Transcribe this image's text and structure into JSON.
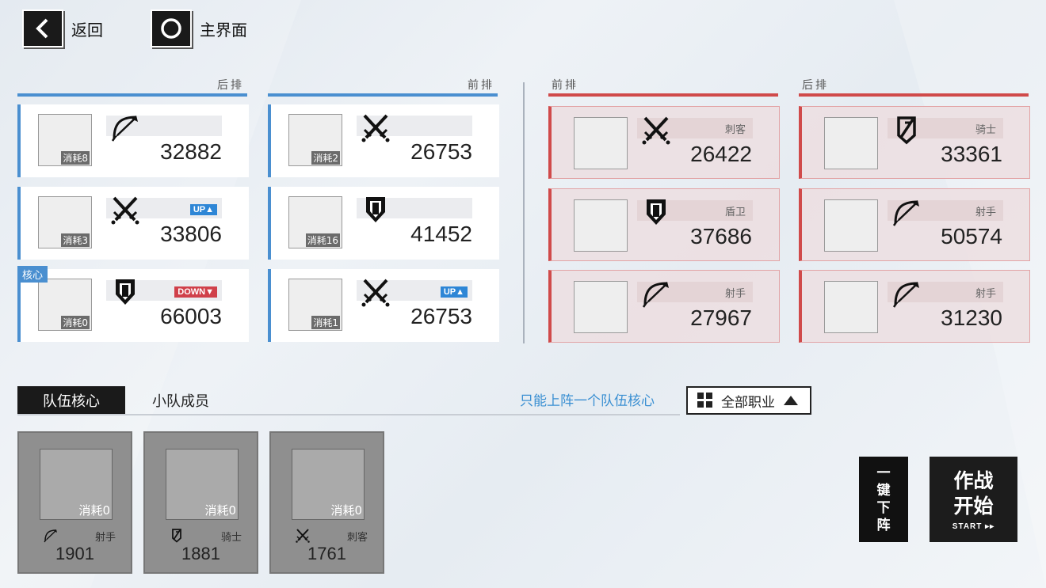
{
  "nav": {
    "back_label": "返回",
    "home_label": "主界面"
  },
  "sections": {
    "ally_back": "后排",
    "ally_front": "前排",
    "enemy_front": "前排",
    "enemy_back": "后排"
  },
  "ally_back": [
    {
      "cost": "消耗8",
      "class_icon": "bow-icon",
      "power": "32882",
      "badge": "",
      "core": ""
    },
    {
      "cost": "消耗3",
      "class_icon": "daggers-icon",
      "power": "33806",
      "badge": "UP▲",
      "core": ""
    },
    {
      "cost": "消耗0",
      "class_icon": "shield-icon",
      "power": "66003",
      "badge": "DOWN▼",
      "core": "核心"
    }
  ],
  "ally_front": [
    {
      "cost": "消耗2",
      "class_icon": "daggers-icon",
      "power": "26753",
      "badge": ""
    },
    {
      "cost": "消耗16",
      "class_icon": "shield-icon",
      "power": "41452",
      "badge": ""
    },
    {
      "cost": "消耗1",
      "class_icon": "daggers-icon",
      "power": "26753",
      "badge": "UP▲"
    }
  ],
  "enemy_front": [
    {
      "class_icon": "daggers-icon",
      "class": "刺客",
      "power": "26422"
    },
    {
      "class_icon": "shield-icon",
      "class": "盾卫",
      "power": "37686"
    },
    {
      "class_icon": "bow-icon",
      "class": "射手",
      "power": "27967"
    }
  ],
  "enemy_back": [
    {
      "class_icon": "knight-icon",
      "class": "骑士",
      "power": "33361"
    },
    {
      "class_icon": "bow-icon",
      "class": "射手",
      "power": "50574"
    },
    {
      "class_icon": "bow-icon",
      "class": "射手",
      "power": "31230"
    }
  ],
  "tabs": {
    "core": "队伍核心",
    "members": "小队成员"
  },
  "hint": "只能上阵一个队伍核心",
  "filter": {
    "label": "全部职业"
  },
  "pool": [
    {
      "cost": "消耗0",
      "class": "射手",
      "class_icon": "bow-icon",
      "power": "1901"
    },
    {
      "cost": "消耗0",
      "class": "骑士",
      "class_icon": "knight-icon",
      "power": "1881"
    },
    {
      "cost": "消耗0",
      "class": "刺客",
      "class_icon": "daggers-icon",
      "power": "1761"
    }
  ],
  "buttons": {
    "unload": [
      "一",
      "键",
      "下",
      "阵"
    ],
    "start_line1": "作战",
    "start_line2": "开始",
    "start_sub": "START ▸▸"
  },
  "colors": {
    "ally": "#4a8fd0",
    "enemy": "#d04a4a",
    "hint": "#3a8fd2"
  }
}
